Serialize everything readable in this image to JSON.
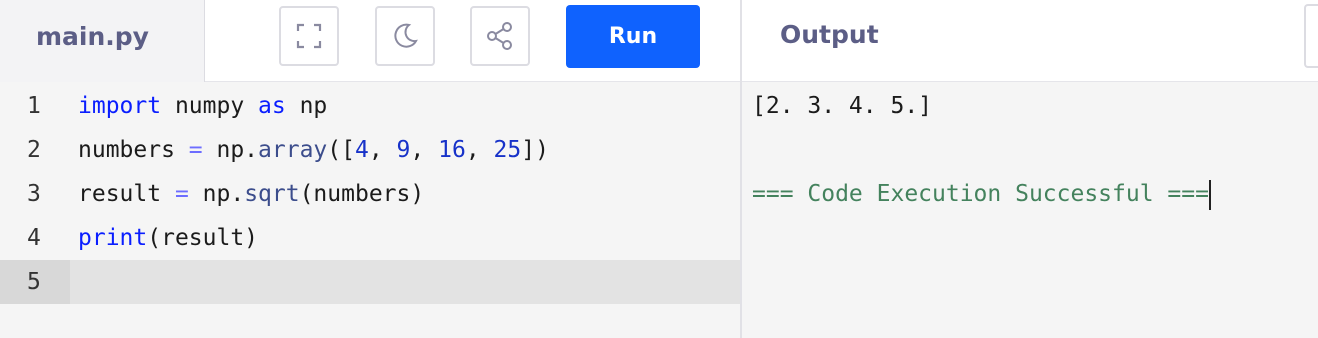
{
  "editor": {
    "file_tab": "main.py",
    "toolbar": {
      "fullscreen_icon": "fullscreen-icon",
      "theme_icon": "moon-icon",
      "share_icon": "share-icon",
      "run_label": "Run"
    },
    "lines": [
      {
        "num": "1",
        "tokens": [
          {
            "t": "import",
            "c": "kw"
          },
          {
            "t": " numpy ",
            "c": ""
          },
          {
            "t": "as",
            "c": "kw"
          },
          {
            "t": " np",
            "c": ""
          }
        ]
      },
      {
        "num": "2",
        "tokens": [
          {
            "t": "numbers ",
            "c": ""
          },
          {
            "t": "=",
            "c": "op"
          },
          {
            "t": " np.",
            "c": ""
          },
          {
            "t": "array",
            "c": "fn"
          },
          {
            "t": "([",
            "c": ""
          },
          {
            "t": "4",
            "c": "num"
          },
          {
            "t": ", ",
            "c": ""
          },
          {
            "t": "9",
            "c": "num"
          },
          {
            "t": ", ",
            "c": ""
          },
          {
            "t": "16",
            "c": "num"
          },
          {
            "t": ", ",
            "c": ""
          },
          {
            "t": "25",
            "c": "num"
          },
          {
            "t": "])",
            "c": ""
          }
        ]
      },
      {
        "num": "3",
        "tokens": [
          {
            "t": "result ",
            "c": ""
          },
          {
            "t": "=",
            "c": "op"
          },
          {
            "t": " np.",
            "c": ""
          },
          {
            "t": "sqrt",
            "c": "fn"
          },
          {
            "t": "(numbers)",
            "c": ""
          }
        ]
      },
      {
        "num": "4",
        "tokens": [
          {
            "t": "print",
            "c": "kw"
          },
          {
            "t": "(result)",
            "c": ""
          }
        ]
      },
      {
        "num": "5",
        "tokens": []
      }
    ],
    "active_line": 5
  },
  "output": {
    "label": "Output",
    "lines": [
      "[2. 3. 4. 5.]",
      "",
      "=== Code Execution Successful ==="
    ]
  },
  "colors": {
    "run_button": "#0f62fe",
    "keyword": "#0a1eff",
    "success": "#44825d"
  }
}
